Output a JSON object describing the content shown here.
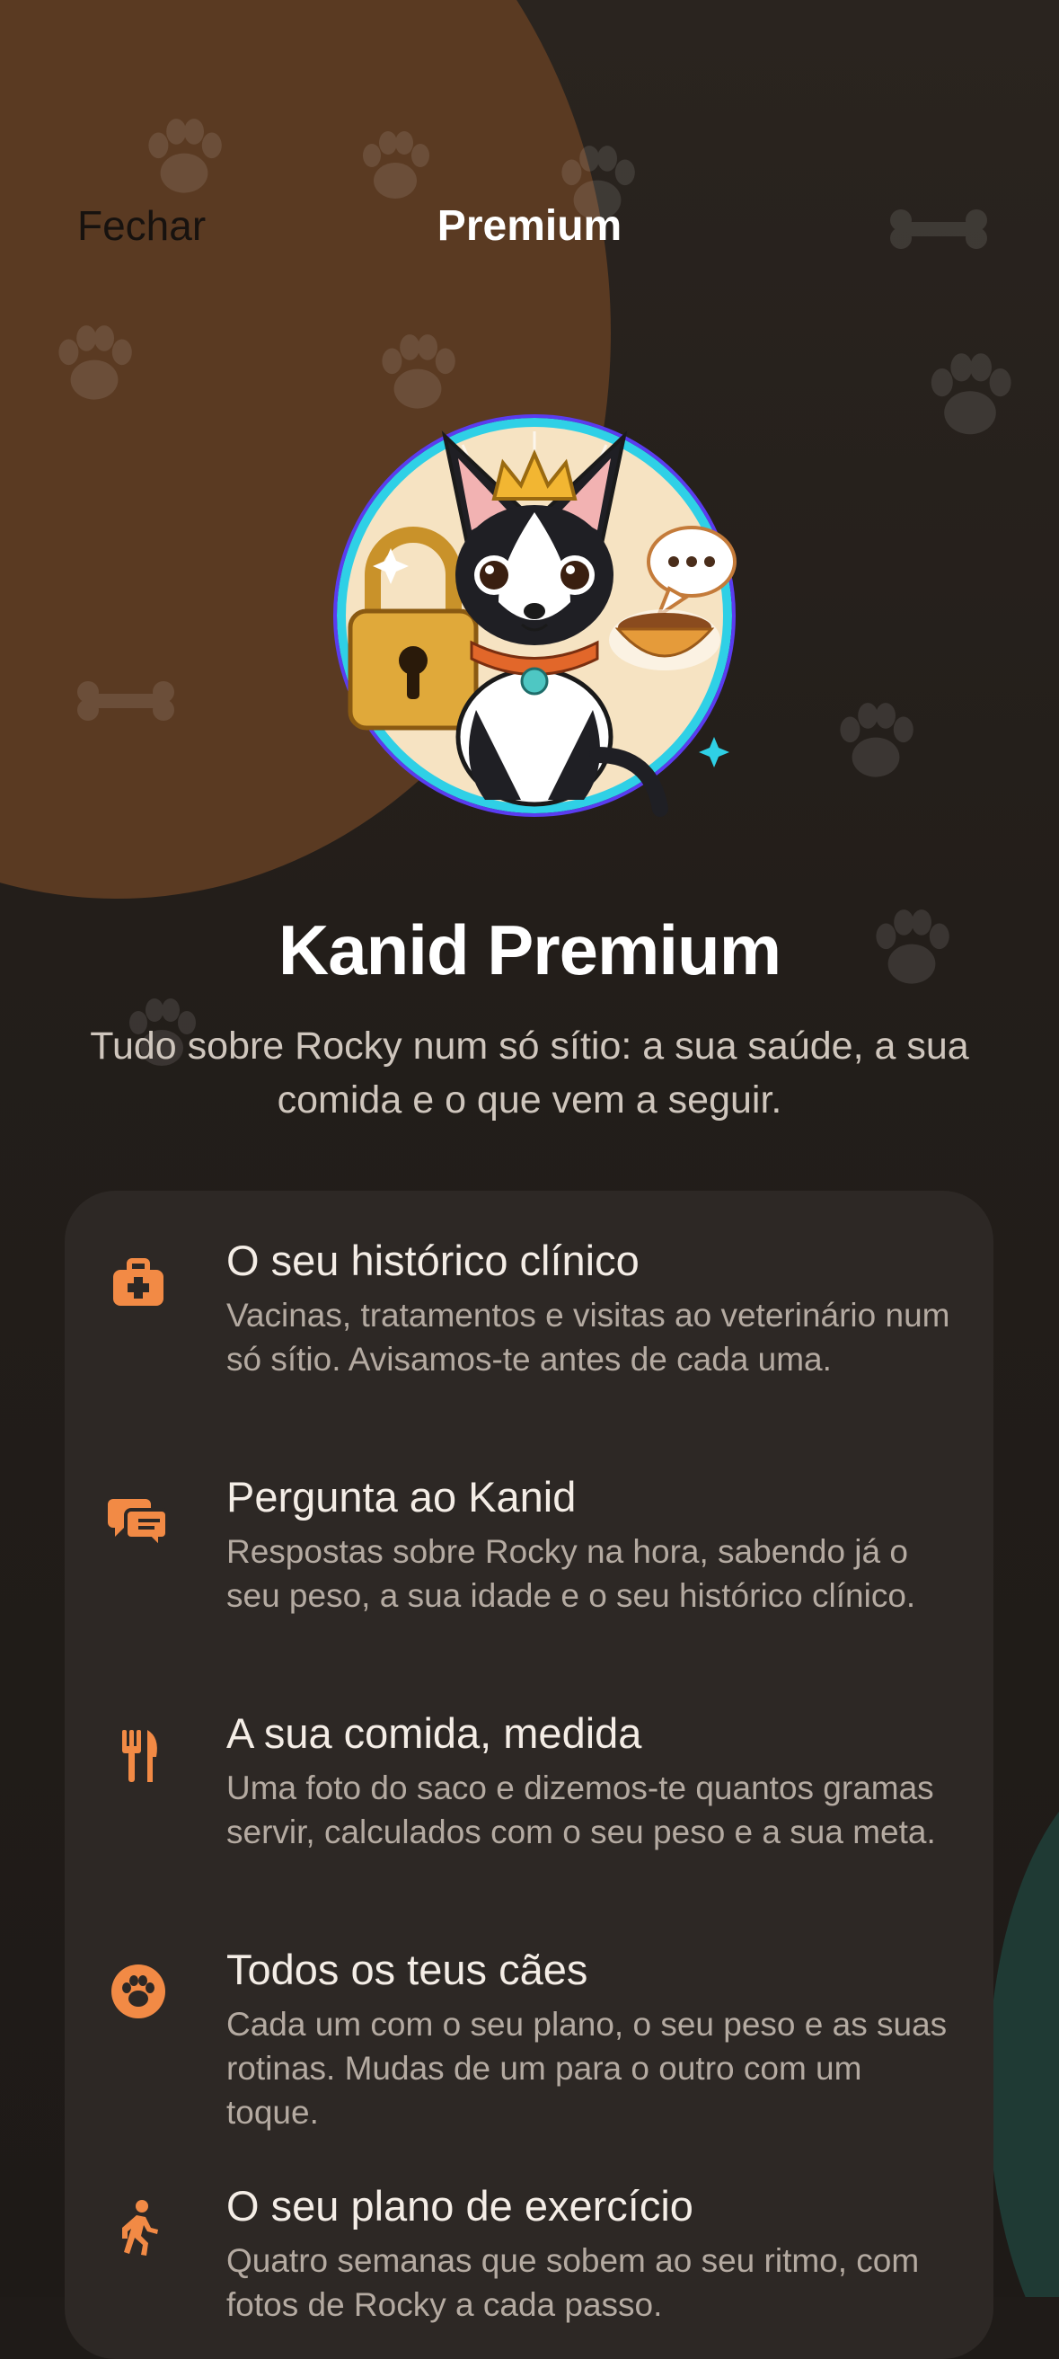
{
  "header": {
    "close_label": "Fechar",
    "title": "Premium"
  },
  "hero": {
    "image": "chihuahua-with-crown-padlock-food-bowl-illustration"
  },
  "headline": "Kanid Premium",
  "subtitle": "Tudo sobre Rocky num só sítio: a sua saúde, a sua comida e o que vem a seguir.",
  "features": [
    {
      "icon": "medical-kit-icon",
      "title": "O seu histórico clínico",
      "desc": "Vacinas, tratamentos e visitas ao veterinário num só sítio. Avisamos-te antes de cada uma."
    },
    {
      "icon": "chat-bubbles-icon",
      "title": "Pergunta ao Kanid",
      "desc": "Respostas sobre Rocky na hora, sabendo já o seu peso, a sua idade e o seu histórico clínico."
    },
    {
      "icon": "fork-knife-icon",
      "title": "A sua comida, medida",
      "desc": "Uma foto do saco e dizemos-te quantos gramas servir, calculados com o seu peso e a sua meta."
    },
    {
      "icon": "paw-icon",
      "title": "Todos os teus cães",
      "desc": "Cada um com o seu plano, o seu peso e as suas rotinas. Mudas de um para o outro com um toque."
    },
    {
      "icon": "walking-icon",
      "title": "O seu plano de exercício",
      "desc": "Quatro semanas que sobem ao seu ritmo, com fotos de Rocky a cada passo."
    }
  ],
  "colors": {
    "accent": "#f28a45",
    "background": "#1f1b18",
    "card": "#2d2825",
    "blob": "#5a3a22"
  }
}
